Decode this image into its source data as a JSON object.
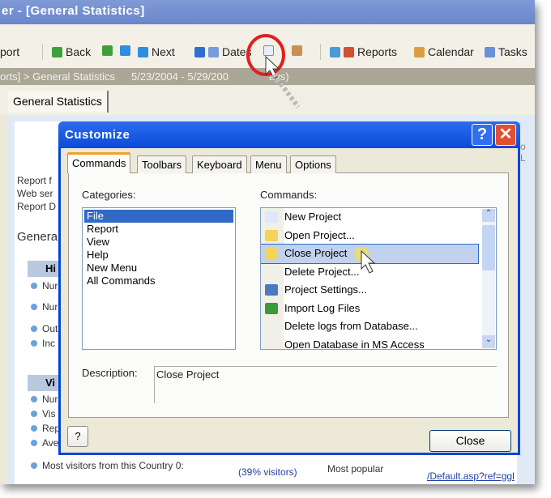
{
  "window": {
    "title": "er - [General Statistics]"
  },
  "toolbar": {
    "items": [
      {
        "label": "port"
      },
      {
        "label": "Back",
        "icon": "back-arrow-icon"
      },
      {
        "label": "",
        "icon": "forward-arrow-icon"
      },
      {
        "label": "",
        "icon": "up-arrow-icon"
      },
      {
        "label": "Next",
        "icon": "down-arrow-icon"
      },
      {
        "label": "Dates",
        "icon": "dates-icon"
      },
      {
        "label": "Reports",
        "icon": "reports-icon"
      },
      {
        "label": "Calendar",
        "icon": "calendar-icon"
      },
      {
        "label": "Tasks",
        "icon": "tasks-icon"
      }
    ]
  },
  "breadcrumb": {
    "path": "orts] > General Statistics",
    "range": "5/23/2004 - 5/29/200",
    "suffix": "ays)"
  },
  "doc_tab": "General Statistics",
  "background": {
    "lines": [
      "Report f",
      "Web ser",
      "Report D"
    ],
    "section": "General",
    "table1_header": "Hi",
    "table1_rows": [
      "Nur",
      "Nur",
      "Out",
      "Inc"
    ],
    "table2_header": "Vi",
    "table2_rows": [
      "Nur",
      "Vis",
      "Rep",
      "Ave"
    ],
    "country": "Most visitors from this Country 0:",
    "visitors": "(39% visitors)",
    "popular": "Most popular",
    "link": "/Default.asp?ref=ggl",
    "right_fragment": "o L"
  },
  "dialog": {
    "title": "Customize",
    "tabs": [
      "Commands",
      "Toolbars",
      "Keyboard",
      "Menu",
      "Options"
    ],
    "active_tab": "Commands",
    "categories_label": "Categories:",
    "categories": [
      "File",
      "Report",
      "View",
      "Help",
      "New Menu",
      "All Commands"
    ],
    "selected_category": "File",
    "commands_label": "Commands:",
    "commands": [
      {
        "label": "New Project",
        "icon": "new-document-icon",
        "color": "#dfe8f8"
      },
      {
        "label": "Open Project...",
        "icon": "open-folder-icon",
        "color": "#f2d35c"
      },
      {
        "label": "Close Project",
        "icon": "close-folder-icon",
        "color": "#f2d35c"
      },
      {
        "label": "Delete Project...",
        "icon": "",
        "color": ""
      },
      {
        "label": "Project Settings...",
        "icon": "project-settings-icon",
        "color": "#4a7ac0"
      },
      {
        "label": "Import Log Files",
        "icon": "import-icon",
        "color": "#3a9a3a"
      },
      {
        "label": "Delete logs from Database...",
        "icon": "",
        "color": ""
      },
      {
        "label": "Open Database in MS Access",
        "icon": "",
        "color": ""
      }
    ],
    "selected_command": "Close Project",
    "description_label": "Description:",
    "description": "Close Project",
    "close_label": "Close",
    "help_label": "?"
  },
  "colors": {
    "selection": "#316ac5",
    "dialog_title": "#0a4ad8",
    "annotation_circle": "#e02020"
  }
}
